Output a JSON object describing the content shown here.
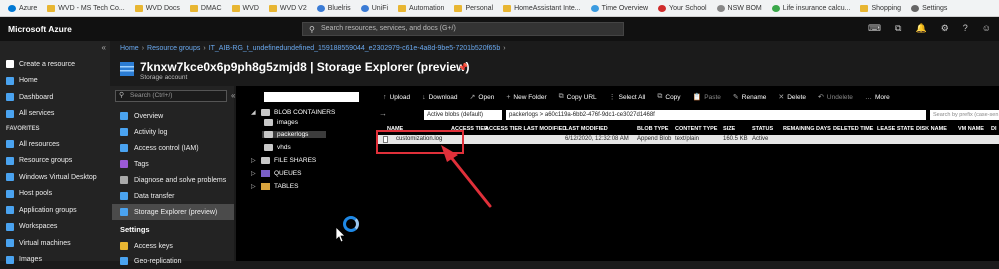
{
  "bookmarks": [
    {
      "label": "Azure",
      "color": "#0078d4",
      "folder": false
    },
    {
      "label": "WVD - MS Tech Co...",
      "color": "#e8b632",
      "folder": true
    },
    {
      "label": "WVD Docs",
      "color": "#e8b632",
      "folder": true
    },
    {
      "label": "DMAC",
      "color": "#e8b632",
      "folder": true
    },
    {
      "label": "WVD",
      "color": "#e8b632",
      "folder": true
    },
    {
      "label": "WVD V2",
      "color": "#e8b632",
      "folder": true
    },
    {
      "label": "Bluelris",
      "color": "#3a7bd5",
      "folder": false
    },
    {
      "label": "UniFi",
      "color": "#3a7bd5",
      "folder": false
    },
    {
      "label": "Automation",
      "color": "#e8b632",
      "folder": true
    },
    {
      "label": "Personal",
      "color": "#e8b632",
      "folder": true
    },
    {
      "label": "HomeAssistant Inte...",
      "color": "#e8b632",
      "folder": true
    },
    {
      "label": "Time Overview",
      "color": "#3a9be0",
      "folder": false
    },
    {
      "label": "Your School",
      "color": "#d02c2c",
      "folder": false
    },
    {
      "label": "NSW BOM",
      "color": "#888888",
      "folder": false
    },
    {
      "label": "Life insurance calcu...",
      "color": "#3aa84a",
      "folder": false
    },
    {
      "label": "Shopping",
      "color": "#e8b632",
      "folder": true
    },
    {
      "label": "Settings",
      "color": "#666666",
      "folder": false
    }
  ],
  "topbar": {
    "brand": "Microsoft Azure",
    "search_placeholder": "Search resources, services, and docs (G+/)"
  },
  "nav": {
    "items_top": [
      {
        "label": "Create a resource",
        "icon": "plus-icon",
        "color": "#ffffff"
      },
      {
        "label": "Home",
        "icon": "home-icon",
        "color": "#4aa3f0"
      },
      {
        "label": "Dashboard",
        "icon": "dashboard-icon",
        "color": "#4aa3f0"
      },
      {
        "label": "All services",
        "icon": "list-icon",
        "color": "#4aa3f0"
      }
    ],
    "favorites_header": "FAVORITES",
    "items_fav": [
      {
        "label": "All resources",
        "icon": "grid-icon",
        "color": "#4aa3f0"
      },
      {
        "label": "Resource groups",
        "icon": "cube-icon",
        "color": "#4aa3f0"
      },
      {
        "label": "Windows Virtual Desktop",
        "icon": "desktop-icon",
        "color": "#4aa3f0"
      },
      {
        "label": "Host pools",
        "icon": "hostpool-icon",
        "color": "#4aa3f0"
      },
      {
        "label": "Application groups",
        "icon": "appgroup-icon",
        "color": "#4aa3f0"
      },
      {
        "label": "Workspaces",
        "icon": "workspace-icon",
        "color": "#4aa3f0"
      },
      {
        "label": "Virtual machines",
        "icon": "vm-icon",
        "color": "#4aa3f0"
      },
      {
        "label": "Images",
        "icon": "image-icon",
        "color": "#4aa3f0"
      }
    ]
  },
  "breadcrumb": [
    "Home",
    "Resource groups",
    "IT_AIB-RG_t_undefinedundefined_159188559044_e2302979-c61e-4a8d-9be5-7201b520f65b"
  ],
  "resource": {
    "title": "7knxw7kce0x6p9ph8g5zmjd8 | Storage Explorer (preview)",
    "subtitle": "Storage account"
  },
  "resource_menu": {
    "search_placeholder": "Search (Ctrl+/)",
    "items": [
      {
        "label": "Overview",
        "icon": "overview-icon",
        "color": "#4aa3f0",
        "selected": false
      },
      {
        "label": "Activity log",
        "icon": "activity-log-icon",
        "color": "#4aa3f0",
        "selected": false
      },
      {
        "label": "Access control (IAM)",
        "icon": "iam-icon",
        "color": "#4aa3f0",
        "selected": false
      },
      {
        "label": "Tags",
        "icon": "tag-icon",
        "color": "#9b59d6",
        "selected": false
      },
      {
        "label": "Diagnose and solve problems",
        "icon": "diagnose-icon",
        "color": "#aaaaaa",
        "selected": false
      },
      {
        "label": "Data transfer",
        "icon": "data-transfer-icon",
        "color": "#4aa3f0",
        "selected": false
      },
      {
        "label": "Storage Explorer (preview)",
        "icon": "storage-explorer-icon",
        "color": "#4aa3f0",
        "selected": true
      }
    ],
    "settings_header": "Settings",
    "settings_items": [
      {
        "label": "Access keys",
        "icon": "key-icon",
        "color": "#e8b632"
      },
      {
        "label": "Geo-replication",
        "icon": "globe-icon",
        "color": "#4aa3f0"
      }
    ]
  },
  "tree": {
    "blob_containers": "BLOB CONTAINERS",
    "containers": [
      "images",
      "packerlogs",
      "vhds"
    ],
    "file_shares": "FILE SHARES",
    "queues": "QUEUES",
    "tables": "TABLES"
  },
  "toolbar": [
    {
      "label": "Upload",
      "icon": "upload-icon",
      "enabled": true
    },
    {
      "label": "Download",
      "icon": "download-icon",
      "enabled": true
    },
    {
      "label": "Open",
      "icon": "open-icon",
      "enabled": true
    },
    {
      "label": "New Folder",
      "icon": "new-folder-icon",
      "enabled": true
    },
    {
      "label": "Copy URL",
      "icon": "copy-url-icon",
      "enabled": true
    },
    {
      "label": "Select All",
      "icon": "select-all-icon",
      "enabled": true
    },
    {
      "label": "Copy",
      "icon": "copy-icon",
      "enabled": true
    },
    {
      "label": "Paste",
      "icon": "paste-icon",
      "enabled": false
    },
    {
      "label": "Rename",
      "icon": "rename-icon",
      "enabled": true
    },
    {
      "label": "Delete",
      "icon": "delete-icon",
      "enabled": true
    },
    {
      "label": "Undelete",
      "icon": "undelete-icon",
      "enabled": false
    },
    {
      "label": "More",
      "icon": "more-icon",
      "enabled": true
    }
  ],
  "pathbar": {
    "view": "Active blobs (default)",
    "path": "packerlogs  >  a60c119a-6bb2-476f-9dc1-ce3027d1468f",
    "filter_placeholder": "Search by prefix (case-sen"
  },
  "columns": [
    "NAME",
    "ACCESS TIER",
    "ACCESS TIER LAST MODIFIED",
    "LAST MODIFIED",
    "BLOB TYPE",
    "CONTENT TYPE",
    "SIZE",
    "STATUS",
    "REMAINING DAYS",
    "DELETED TIME",
    "LEASE STATE",
    "DISK NAME",
    "VM NAME",
    "DI"
  ],
  "blobs": [
    {
      "name": "customization.log",
      "access_tier": "",
      "tier_modified": "",
      "last_modified": "6/12/2020, 12:32:08 AM",
      "blob_type": "Append Blob",
      "content_type": "text/plain",
      "size": "160.5 KB",
      "status": "Active"
    }
  ],
  "annotation": {
    "color": "#e0303a"
  }
}
